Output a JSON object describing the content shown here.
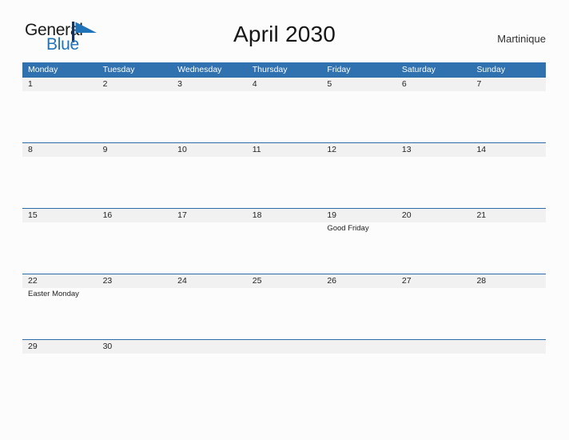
{
  "brand": {
    "name_part1": "General",
    "name_part2": "Blue",
    "mark": "triangle-flag-icon",
    "accent_color": "#2173b8"
  },
  "header": {
    "title": "April 2030",
    "location": "Martinique"
  },
  "colors": {
    "header_blue": "#3071b0",
    "row_divider_blue": "#2b6ca9",
    "date_band_gray": "#f1f1f1",
    "page_background": "#fcfcfc"
  },
  "calendar": {
    "month": "April",
    "year": "2030",
    "weekday_headers": [
      "Monday",
      "Tuesday",
      "Wednesday",
      "Thursday",
      "Friday",
      "Saturday",
      "Sunday"
    ],
    "weeks": [
      {
        "days": [
          {
            "date": "1",
            "event": ""
          },
          {
            "date": "2",
            "event": ""
          },
          {
            "date": "3",
            "event": ""
          },
          {
            "date": "4",
            "event": ""
          },
          {
            "date": "5",
            "event": ""
          },
          {
            "date": "6",
            "event": ""
          },
          {
            "date": "7",
            "event": ""
          }
        ]
      },
      {
        "days": [
          {
            "date": "8",
            "event": ""
          },
          {
            "date": "9",
            "event": ""
          },
          {
            "date": "10",
            "event": ""
          },
          {
            "date": "11",
            "event": ""
          },
          {
            "date": "12",
            "event": ""
          },
          {
            "date": "13",
            "event": ""
          },
          {
            "date": "14",
            "event": ""
          }
        ]
      },
      {
        "days": [
          {
            "date": "15",
            "event": ""
          },
          {
            "date": "16",
            "event": ""
          },
          {
            "date": "17",
            "event": ""
          },
          {
            "date": "18",
            "event": ""
          },
          {
            "date": "19",
            "event": "Good Friday"
          },
          {
            "date": "20",
            "event": ""
          },
          {
            "date": "21",
            "event": ""
          }
        ]
      },
      {
        "days": [
          {
            "date": "22",
            "event": "Easter Monday"
          },
          {
            "date": "23",
            "event": ""
          },
          {
            "date": "24",
            "event": ""
          },
          {
            "date": "25",
            "event": ""
          },
          {
            "date": "26",
            "event": ""
          },
          {
            "date": "27",
            "event": ""
          },
          {
            "date": "28",
            "event": ""
          }
        ]
      },
      {
        "days": [
          {
            "date": "29",
            "event": ""
          },
          {
            "date": "30",
            "event": ""
          },
          {
            "date": "",
            "event": ""
          },
          {
            "date": "",
            "event": ""
          },
          {
            "date": "",
            "event": ""
          },
          {
            "date": "",
            "event": ""
          },
          {
            "date": "",
            "event": ""
          }
        ]
      }
    ]
  }
}
